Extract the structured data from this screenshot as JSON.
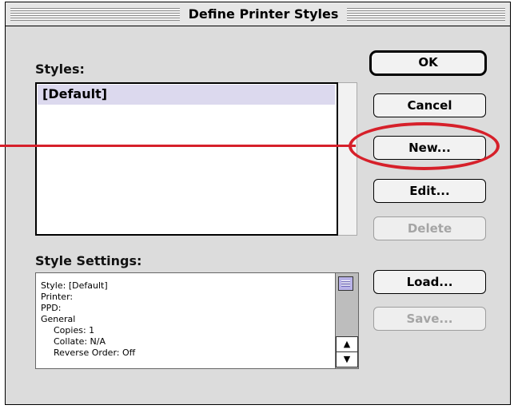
{
  "window": {
    "title": "Define Printer Styles"
  },
  "styles": {
    "label": "Styles:",
    "items": [
      "[Default]"
    ],
    "selected_index": 0
  },
  "settings": {
    "label": "Style Settings:",
    "lines": [
      "Style: [Default]",
      "Printer:",
      "PPD:",
      "General",
      "Copies: 1",
      "Collate: N/A",
      "Reverse Order: Off"
    ]
  },
  "buttons": {
    "ok": "OK",
    "cancel": "Cancel",
    "new": "New...",
    "edit": "Edit...",
    "delete": "Delete",
    "load": "Load...",
    "save": "Save..."
  },
  "scroll": {
    "up_arrow": "▲",
    "down_arrow": "▼"
  },
  "annotation": {
    "color": "#d6202a",
    "highlighted": "new-button"
  }
}
